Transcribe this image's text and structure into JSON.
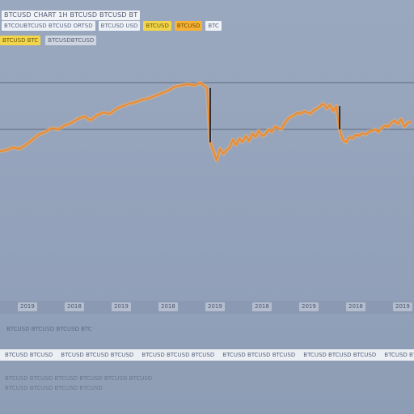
{
  "header": {
    "title": "BTCUSD CHART 1H BTCUSD BTCUSD BT",
    "chips": [
      {
        "label": "BTCOUBTCUSD BTCUSD ORTSD",
        "style": "plain"
      },
      {
        "label": "BTCUSD USD",
        "style": "plain"
      },
      {
        "label": "BTCUSD",
        "style": "yellow"
      },
      {
        "label": "BTCUSD",
        "style": "orange"
      },
      {
        "label": "BTC",
        "style": "plain"
      }
    ],
    "row2": [
      {
        "label": "BTCUSD BTC",
        "style": "yellow"
      },
      {
        "label": "BTCUSDBTCUSD",
        "style": "gray"
      }
    ]
  },
  "x_ticks": [
    "2019",
    "2018",
    "2019",
    "2018",
    "2019",
    "2018",
    "2019",
    "2018",
    "2019"
  ],
  "note": "BTCUSD BTCUSD BTCUSD BTC",
  "footer": {
    "items": [
      "BTCUSD BTCUSD",
      "BTCUSD BTCUSD BTCUSD",
      "BTCUSD BTCUSD BTCUSD",
      "BTCUSD BTCUSD BTCUSD",
      "BTCUSD BTCUSD BTCUSD",
      "BTCUSD BTCUSD"
    ],
    "line2": "BTCUSD BTCUSD BTCUSD BTCUSD BTCUSD BTCUSD",
    "line3": "BTCUSD BTCUSD BTCUSD BTCUSD"
  },
  "chart_data": {
    "type": "line",
    "title": "BTCUSD CHART 1H BTCUSD BTCUSD BT",
    "xlabel": "",
    "ylabel": "",
    "grid": false,
    "reference_lines": [
      {
        "y": 86
      },
      {
        "y": 50
      }
    ],
    "series": [
      {
        "color": "#f08a2a",
        "x": [
          0,
          8,
          16,
          24,
          32,
          40,
          48,
          56,
          64,
          72,
          80,
          88,
          96,
          104,
          112,
          120,
          128,
          136,
          144,
          152,
          160,
          168,
          176,
          184,
          192,
          200,
          208,
          216,
          224,
          232,
          240,
          248,
          256,
          260,
          264,
          268,
          272,
          276,
          280,
          284,
          288,
          292,
          296,
          300,
          304,
          308,
          312,
          316,
          320,
          324,
          328,
          332,
          336,
          340,
          344,
          348,
          352,
          356,
          360,
          364,
          368,
          372,
          376,
          380,
          384,
          388,
          392,
          396,
          400,
          404,
          408,
          412,
          416,
          420,
          424,
          428,
          432,
          436,
          440,
          444,
          448,
          452,
          456,
          460,
          464,
          468,
          472,
          476,
          480,
          484,
          488,
          492,
          496,
          500,
          504,
          508
        ],
        "y": [
          33,
          34,
          36,
          35,
          38,
          42,
          46,
          48,
          51,
          50,
          53,
          55,
          58,
          60,
          57,
          61,
          63,
          62,
          66,
          68,
          70,
          71,
          73,
          74,
          76,
          78,
          80,
          83,
          84,
          85,
          84,
          86,
          82,
          40,
          33,
          26,
          35,
          31,
          34,
          36,
          42,
          38,
          43,
          40,
          45,
          41,
          47,
          44,
          49,
          45,
          46,
          50,
          48,
          52,
          51,
          50,
          55,
          58,
          60,
          61,
          63,
          62,
          64,
          63,
          62,
          65,
          66,
          68,
          70,
          66,
          69,
          64,
          68,
          50,
          42,
          40,
          44,
          43,
          46,
          45,
          47,
          46,
          48,
          49,
          50,
          48,
          51,
          53,
          52,
          55,
          57,
          54,
          58,
          52,
          55,
          56
        ]
      }
    ]
  }
}
